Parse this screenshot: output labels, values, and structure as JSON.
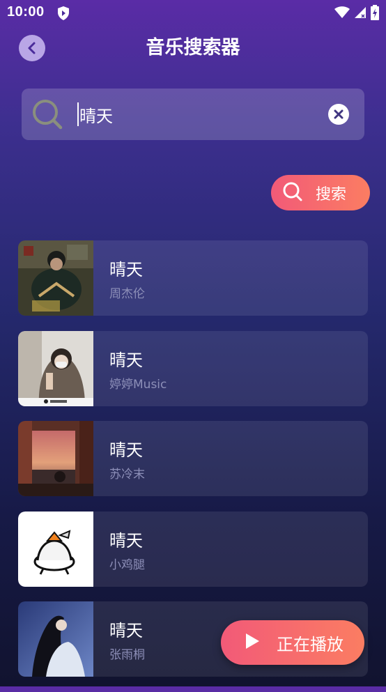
{
  "status_bar": {
    "time": "10:00"
  },
  "header": {
    "title": "音乐搜索器",
    "back_icon": "chevron-left-icon"
  },
  "search": {
    "query": "晴天",
    "clear_icon": "close-circle-icon"
  },
  "search_button": {
    "label": "搜索",
    "icon": "search-icon"
  },
  "results": [
    {
      "title": "晴天",
      "artist": "周杰伦"
    },
    {
      "title": "晴天",
      "artist": "婷婷Music"
    },
    {
      "title": "晴天",
      "artist": "苏冷末"
    },
    {
      "title": "晴天",
      "artist": "小鸡腿"
    },
    {
      "title": "晴天",
      "artist": "张雨桐"
    }
  ],
  "now_playing": {
    "label": "正在播放",
    "icon": "play-icon"
  },
  "colors": {
    "accent_start": "#f25a78",
    "accent_end": "#fb7d62",
    "back_button": "#b9a6e6",
    "artist_text": "#8d8fb8"
  }
}
